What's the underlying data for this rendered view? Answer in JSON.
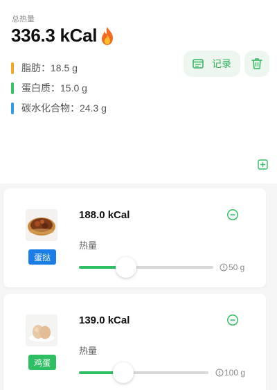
{
  "summary": {
    "total_label": "总热量",
    "total_value": "336.3 kCal",
    "icon": "fire-icon",
    "macros": [
      {
        "label": "脂肪：18.5 g",
        "color": "#f5a623"
      },
      {
        "label": "蛋白质：15.0 g",
        "color": "#37c263"
      },
      {
        "label": "碳水化合物：24.3 g",
        "color": "#2e9be6"
      }
    ],
    "record_label": "记录",
    "record_icon": "note-icon",
    "delete_icon": "trash-icon",
    "add_icon": "plus-square-icon"
  },
  "foods": [
    {
      "kcal": "188.0 kCal",
      "heat_label": "热量",
      "tag": "蛋挞",
      "tag_color": "#1a7ee6",
      "weight": "50 g",
      "slider_fraction": 0.35,
      "image": "egg-tart-image"
    },
    {
      "kcal": "139.0 kCal",
      "heat_label": "热量",
      "tag": "鸡蛋",
      "tag_color": "#2fbf63",
      "weight": "100 g",
      "slider_fraction": 0.34,
      "image": "egg-image"
    }
  ],
  "colors": {
    "accent": "#2fbf63",
    "accent_bg": "#eef7ef"
  }
}
